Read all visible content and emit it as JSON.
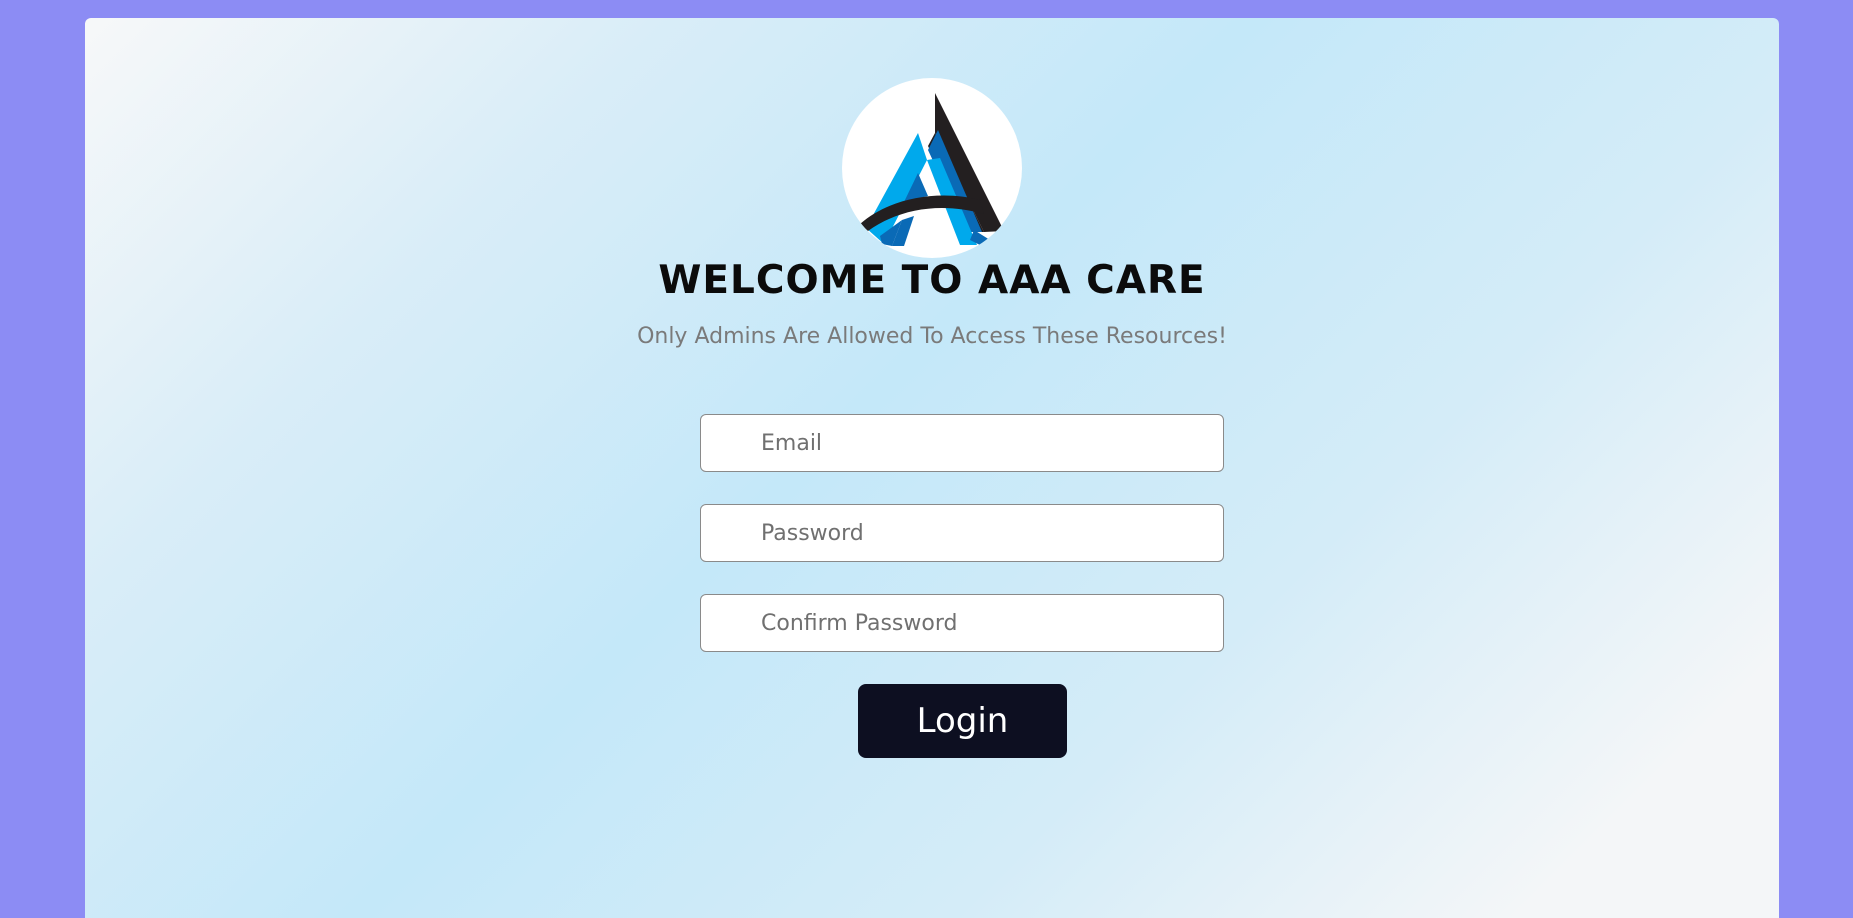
{
  "brand": {
    "logo_icon": "aaa-care-logo",
    "colors": {
      "page_background": "#8c8cf4",
      "logo_dark": "#231f20",
      "logo_light_blue": "#00a9ec",
      "logo_mid_blue": "#0a6ab6",
      "button": "#0d0f21"
    }
  },
  "header": {
    "title": "WELCOME TO AAA CARE",
    "subtitle": "Only Admins Are Allowed To Access These Resources!"
  },
  "form": {
    "email": {
      "placeholder": "Email",
      "value": ""
    },
    "password": {
      "placeholder": "Password",
      "value": ""
    },
    "confirm_password": {
      "placeholder": "Confirm Password",
      "value": ""
    },
    "submit_label": "Login"
  }
}
